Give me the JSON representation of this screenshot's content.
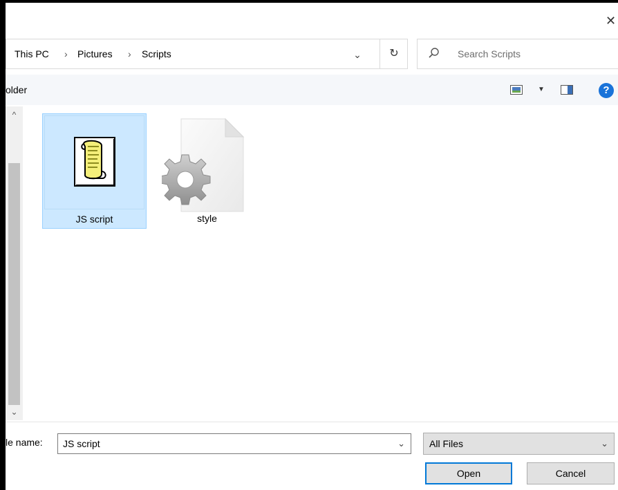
{
  "window": {
    "close_glyph": "✕"
  },
  "address_bar": {
    "breadcrumb": [
      "This PC",
      "Pictures",
      "Scripts"
    ],
    "separator": "›",
    "dropdown_glyph": "⌄",
    "refresh_glyph": "↻"
  },
  "search": {
    "placeholder": "Search Scripts"
  },
  "command_bar": {
    "new_folder_partial": "older"
  },
  "scrollbar": {
    "up_glyph": "^",
    "down_glyph": "⌄"
  },
  "files": [
    {
      "name": "JS script",
      "icon": "js-script-icon",
      "selected": true
    },
    {
      "name": "style",
      "icon": "config-file-gear-icon",
      "selected": false
    }
  ],
  "footer": {
    "file_name_label": "le name:",
    "file_name_value": "JS script",
    "file_type_value": "All Files",
    "dropdown_glyph": "⌄",
    "open_label": "Open",
    "cancel_label": "Cancel"
  },
  "colors": {
    "selection_bg": "#cce8ff",
    "selection_border": "#99d1ff",
    "accent": "#0078d7",
    "help_blue": "#1a73d9"
  }
}
